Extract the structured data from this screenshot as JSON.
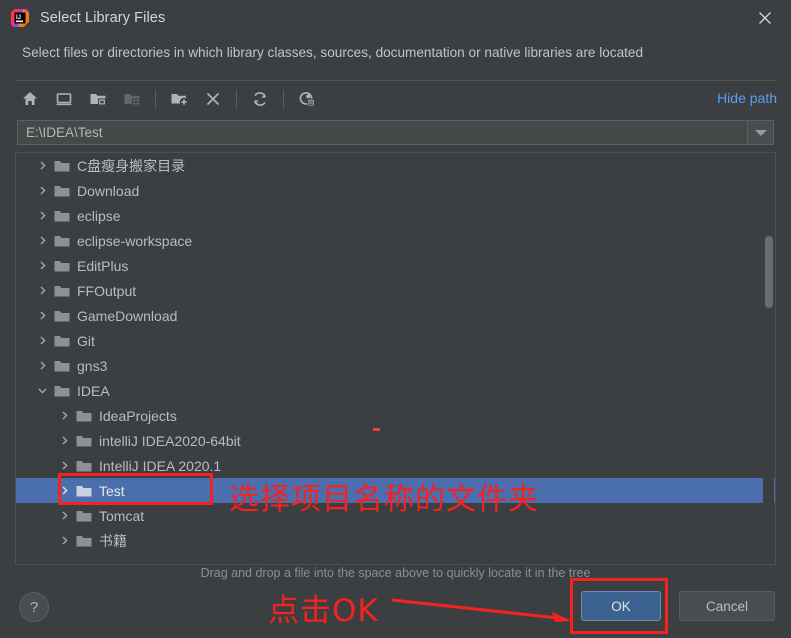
{
  "window": {
    "title": "Select Library Files",
    "app_icon": "intellij-idea-logo",
    "close_label": "✕"
  },
  "description": "Select files or directories in which library classes, sources, documentation or native libraries are located",
  "toolbar": {
    "buttons": [
      {
        "name": "home-icon",
        "tooltip": "Home",
        "enabled": true
      },
      {
        "name": "desktop-icon",
        "tooltip": "Desktop",
        "enabled": true
      },
      {
        "name": "project-folder-icon",
        "tooltip": "Project Directory",
        "enabled": true
      },
      {
        "name": "module-folder-icon",
        "tooltip": "Module Directory",
        "enabled": false
      },
      {
        "name": "new-folder-icon",
        "tooltip": "New Folder",
        "enabled": true
      },
      {
        "name": "delete-icon",
        "tooltip": "Delete",
        "enabled": true
      },
      {
        "name": "refresh-icon",
        "tooltip": "Refresh",
        "enabled": true
      },
      {
        "name": "show-hidden-files-icon",
        "tooltip": "Show Hidden Files and Directories",
        "enabled": true
      }
    ],
    "hide_path_label": "Hide path"
  },
  "path_field": {
    "value": "E:\\IDEA\\Test",
    "placeholder": "",
    "dropdown_icon": "chevron-down-icon"
  },
  "tree": {
    "rows": [
      {
        "label": "C盘瘦身搬家目录",
        "depth": 1,
        "state": "collapsed",
        "selected": false
      },
      {
        "label": "Download",
        "depth": 1,
        "state": "collapsed",
        "selected": false
      },
      {
        "label": "eclipse",
        "depth": 1,
        "state": "collapsed",
        "selected": false
      },
      {
        "label": "eclipse-workspace",
        "depth": 1,
        "state": "collapsed",
        "selected": false
      },
      {
        "label": "EditPlus",
        "depth": 1,
        "state": "collapsed",
        "selected": false
      },
      {
        "label": "FFOutput",
        "depth": 1,
        "state": "collapsed",
        "selected": false
      },
      {
        "label": "GameDownload",
        "depth": 1,
        "state": "collapsed",
        "selected": false
      },
      {
        "label": "Git",
        "depth": 1,
        "state": "collapsed",
        "selected": false
      },
      {
        "label": "gns3",
        "depth": 1,
        "state": "collapsed",
        "selected": false
      },
      {
        "label": "IDEA",
        "depth": 1,
        "state": "expanded",
        "selected": false
      },
      {
        "label": "IdeaProjects",
        "depth": 2,
        "state": "collapsed",
        "selected": false
      },
      {
        "label": "intelliJ IDEA2020-64bit",
        "depth": 2,
        "state": "collapsed",
        "selected": false
      },
      {
        "label": "IntelliJ IDEA 2020.1",
        "depth": 2,
        "state": "collapsed",
        "selected": false
      },
      {
        "label": "Test",
        "depth": 2,
        "state": "collapsed",
        "selected": true
      },
      {
        "label": "Tomcat",
        "depth": 2,
        "state": "collapsed",
        "selected": false
      },
      {
        "label": "书籍",
        "depth": 2,
        "state": "collapsed",
        "selected": false
      }
    ],
    "scrollbar": {
      "name": "vertical-scrollbar"
    }
  },
  "drag_hint": "Drag and drop a file into the space above to quickly locate it in the tree",
  "buttons": {
    "help_label": "?",
    "ok_label": "OK",
    "cancel_label": "Cancel"
  },
  "annotations": {
    "folder_note": "选择项目名称的文件夹",
    "ok_note": "点击OK",
    "color": "#f4231f"
  },
  "colors": {
    "dialog_bg": "#3c3f41",
    "selection_blue": "#4b6eaf",
    "link_blue": "#589df6",
    "ok_button_blue": "#3c628f",
    "annotation_red": "#f4231f",
    "folder_icon": "#8a9298"
  }
}
